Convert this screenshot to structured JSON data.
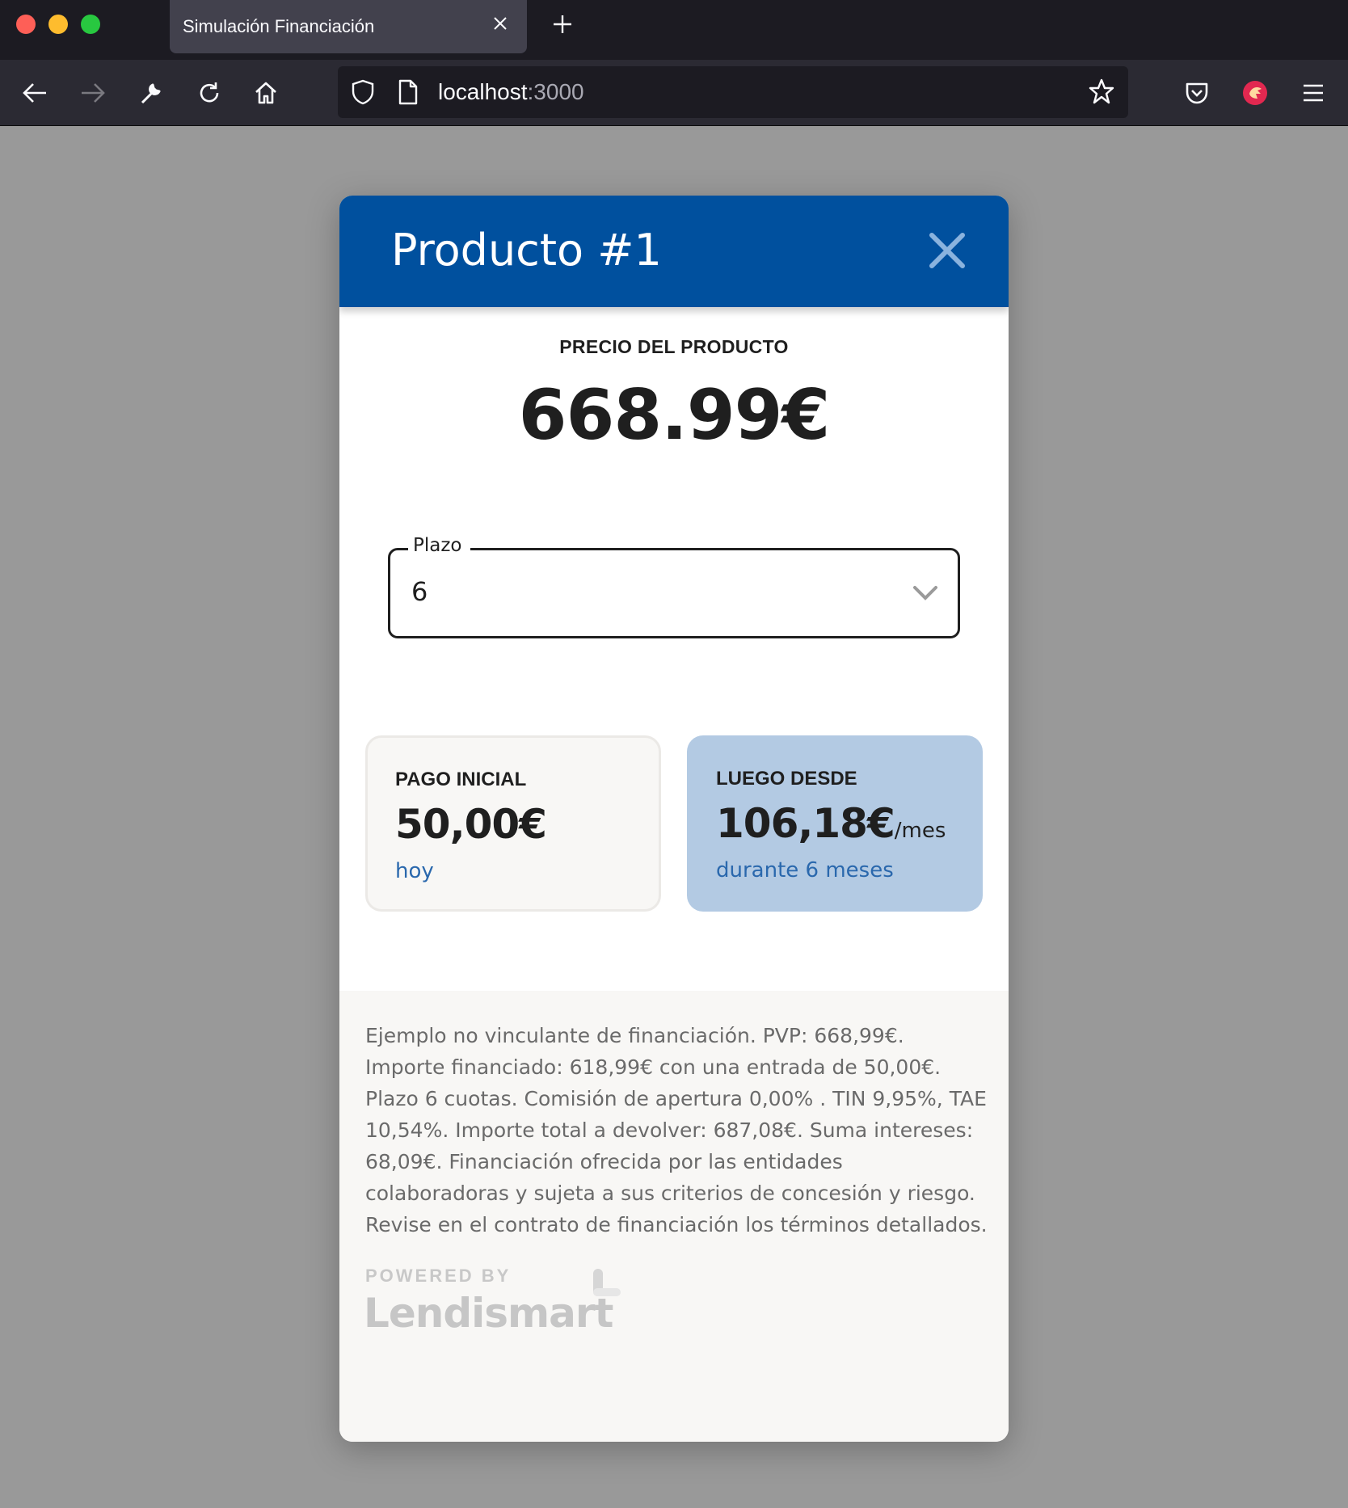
{
  "browser": {
    "tab_title": "Simulación Financiación",
    "url_host": "localhost",
    "url_port": ":3000"
  },
  "modal": {
    "title": "Producto #1",
    "price_label": "PRECIO DEL PRODUCTO",
    "price_value": "668.99€",
    "term_select": {
      "legend": "Plazo",
      "value": "6"
    },
    "initial_payment": {
      "label": "PAGO INICIAL",
      "amount": "50,00€",
      "sub": "hoy"
    },
    "monthly": {
      "label": "LUEGO DESDE",
      "amount": "106,18€",
      "per": "/mes",
      "sub": "durante 6 meses"
    },
    "legal_text": "Ejemplo no vinculante de financiación. PVP: 668,99€. Importe financiado: 618,99€ con una entrada de 50,00€. Plazo 6 cuotas. Comisión de apertura 0,00% . TIN 9,95%, TAE 10,54%. Importe total a devolver: 687,08€. Suma intereses: 68,09€. Financiación ofrecida por las entidades colaboradoras y sujeta a sus criterios de concesión y riesgo. Revise en el contrato de financiación los términos detallados.",
    "powered_by": "POWERED BY",
    "brand": "Lendismart"
  },
  "colors": {
    "header": "#00509e",
    "monthly_card": "#b3cae3",
    "link": "#2a68ad"
  }
}
